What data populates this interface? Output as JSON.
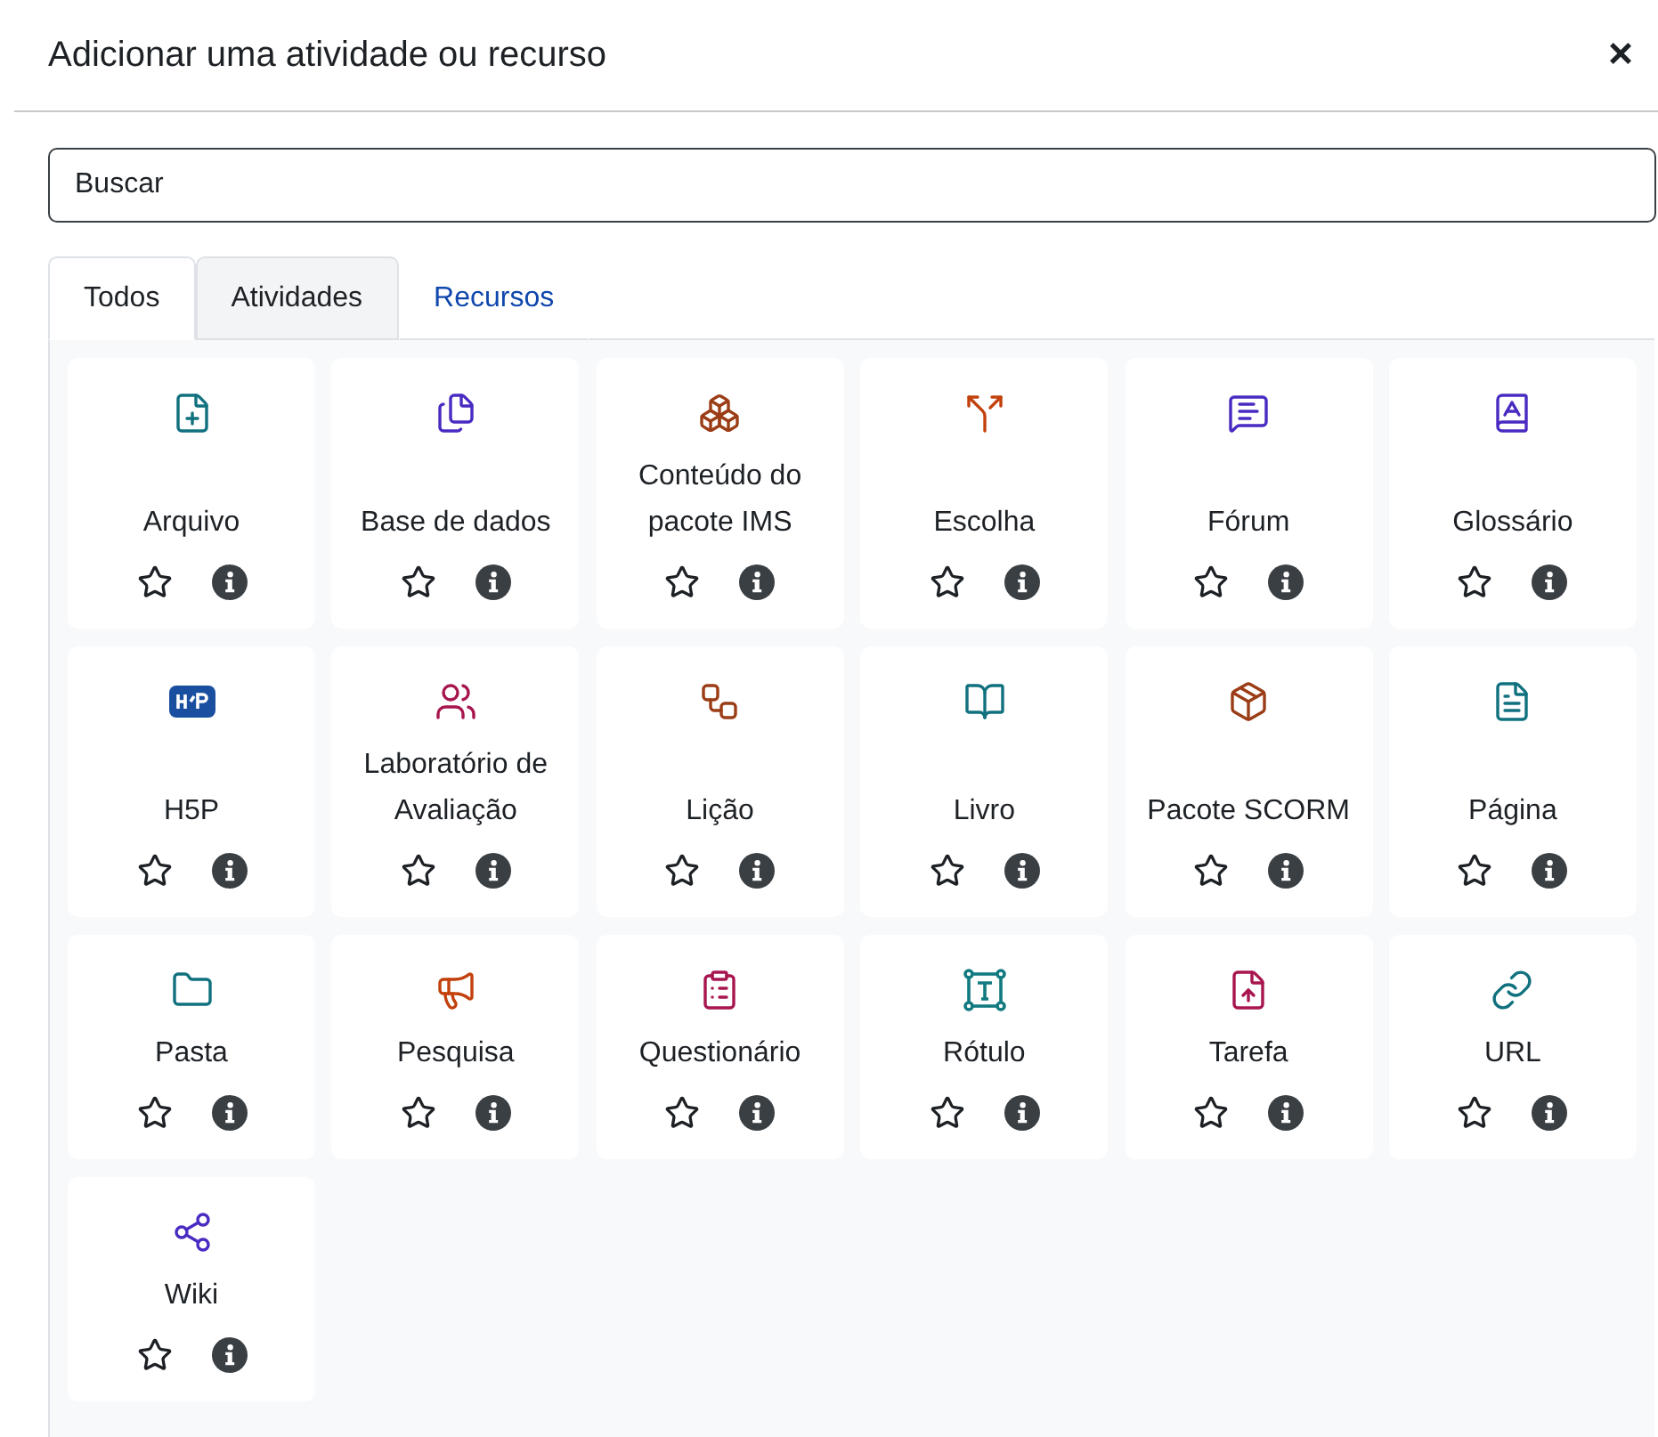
{
  "dialog": {
    "title": "Adicionar uma atividade ou recurso",
    "close": "×"
  },
  "search": {
    "placeholder": "Buscar"
  },
  "tabs": [
    {
      "label": "Todos",
      "selected": true,
      "outlined": true
    },
    {
      "label": "Atividades",
      "selected": false,
      "outlined": true
    },
    {
      "label": "Recursos",
      "selected": false,
      "outlined": false
    }
  ],
  "items": [
    {
      "name": "Arquivo",
      "starred": false
    },
    {
      "name": "Base de dados",
      "starred": false
    },
    {
      "name": "Conteúdo do pacote IMS",
      "starred": false
    },
    {
      "name": "Escolha",
      "starred": false
    },
    {
      "name": "Fórum",
      "starred": false
    },
    {
      "name": "Glossário",
      "starred": false
    },
    {
      "name": "H5P",
      "starred": false
    },
    {
      "name": "Laboratório de Avaliação",
      "starred": false
    },
    {
      "name": "Lição",
      "starred": false
    },
    {
      "name": "Livro",
      "starred": false
    },
    {
      "name": "Pacote SCORM",
      "starred": false
    },
    {
      "name": "Página",
      "starred": false
    },
    {
      "name": "Pasta",
      "starred": false
    },
    {
      "name": "Pesquisa",
      "starred": false
    },
    {
      "name": "Questionário",
      "starred": false
    },
    {
      "name": "Rótulo",
      "starred": false
    },
    {
      "name": "Tarefa",
      "starred": false
    },
    {
      "name": "URL",
      "starred": false
    },
    {
      "name": "Wiki",
      "starred": false
    }
  ]
}
